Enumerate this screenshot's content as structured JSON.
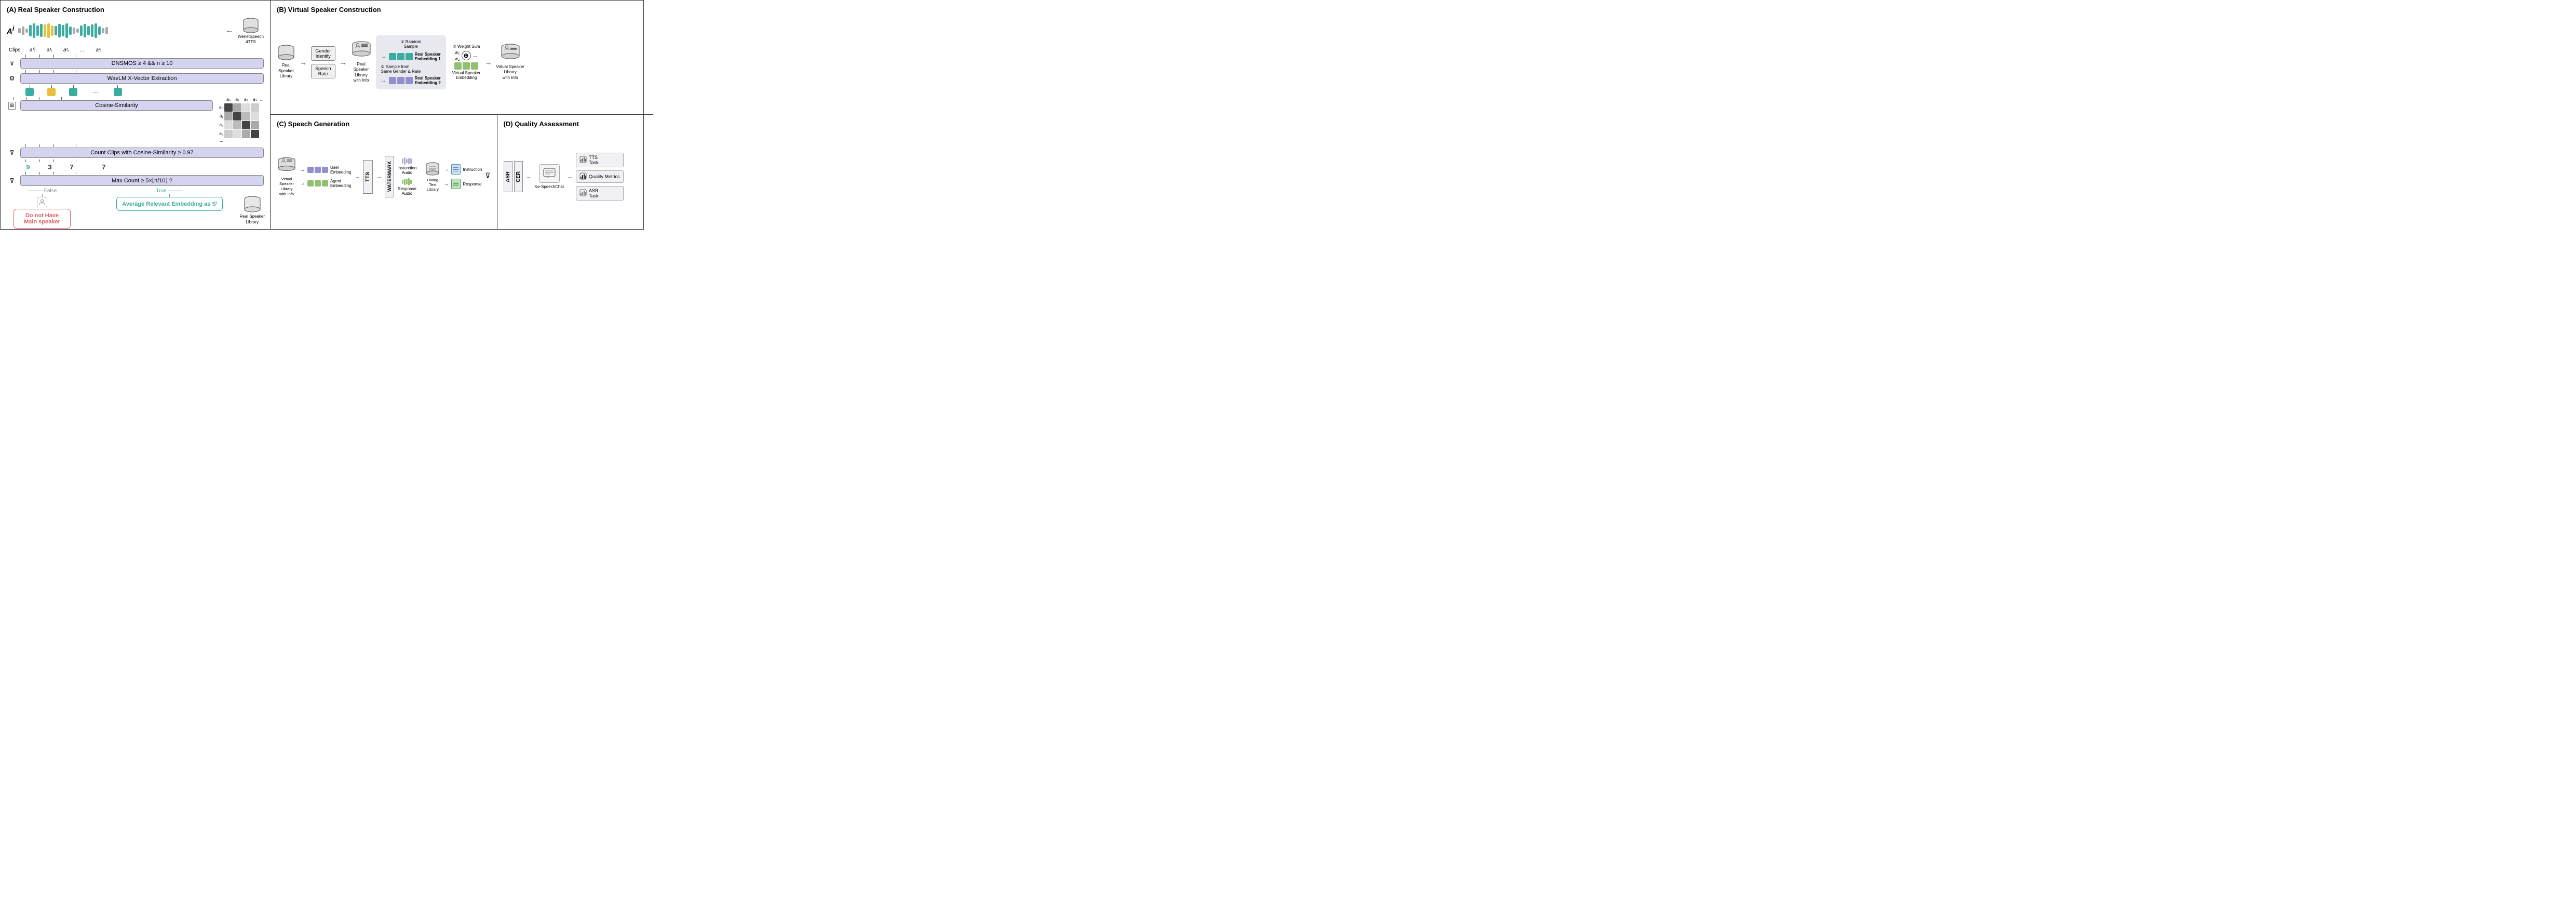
{
  "panels": {
    "a": {
      "title": "(A) Real Speaker Construction",
      "ai_label": "A",
      "ai_superscript": "i",
      "wenet_label": "WenetSpeech\n4TTS",
      "filter1": "DNSMOS ≥ 4 && n ≥ 10",
      "filter2": "WavLM X-Vector Extraction",
      "filter3": "Cosine-Similarity",
      "filter4": "Count Clips with Cosine-Similarity ≥ 0.97",
      "filter5": "Max Count ≥ 5×⌊n/10⌋ ?",
      "clips_label": "Clips",
      "clip_names": [
        "a⁰ᵢ",
        "a¹ᵢ",
        "a²ᵢ",
        "...",
        "aⁿᵢ"
      ],
      "counts": [
        "9",
        "3",
        "7",
        "7"
      ],
      "count_colors": [
        "teal",
        "black",
        "black",
        "black"
      ],
      "false_label": "False",
      "true_label": "True",
      "no_main_speaker": "Do not Have Main speaker",
      "avg_embedding": "Average Relevant Embedding as Sⁱ",
      "real_speaker_library": "Real Speaker\nLibrary",
      "matrix_labels": [
        "a₀",
        "a₁",
        "a₂",
        "a₃"
      ]
    },
    "b": {
      "title": "(B) Virtual Speaker Construction",
      "nodes": [
        {
          "label": "Real\nSpeaker\nLibrary"
        },
        {
          "label": "Gender\nIdentify"
        },
        {
          "label": "Speech\nRate"
        },
        {
          "label": "Real\nSpeaker\nLibrary\nwith Info"
        },
        {
          "label": "Real Speaker\nEmbedding 1"
        },
        {
          "label": "Real Speaker\nEmbedding 2"
        },
        {
          "label": "Virtual Speaker\nEmbedding"
        },
        {
          "label": "Virtual Speaker\nLibrary\nwith Info"
        }
      ],
      "steps": [
        "① Random\nSample",
        "② Sample from\nSame Gender & Rate",
        "③ Weight Sum"
      ],
      "weights": [
        "w₁",
        "w₂"
      ]
    },
    "c": {
      "title": "(C) Speech Generation",
      "nodes": [
        {
          "label": "Virtual\nSpeaker\nLibrary\nwith Info"
        },
        {
          "label": "Dialog\nText\nLibrary"
        }
      ],
      "embeddings": [
        {
          "label": "User Embedding"
        },
        {
          "label": "Agent Embedding"
        },
        {
          "label": "Instruction"
        },
        {
          "label": "Response"
        }
      ],
      "boxes": [
        "TTS",
        "WATERMARK"
      ],
      "audio_labels": [
        "Insturction\nAudio",
        "Response\nAudio"
      ],
      "filter_label": ""
    },
    "d": {
      "title": "(D) Quality Assessment",
      "boxes_vertical": [
        "ASR",
        "CER"
      ],
      "ke_speech": "Ke-SpeechChat",
      "tasks": [
        {
          "label": "TTS\nTask",
          "icon": "📊"
        },
        {
          "label": "Quality\nMetrics",
          "icon": "📊"
        },
        {
          "label": "ASR\nTask",
          "icon": "📊"
        }
      ]
    }
  },
  "colors": {
    "teal": "#3aada0",
    "yellow": "#e8c040",
    "purple": "#9090d0",
    "green": "#90c070",
    "light_purple": "#b0b0e0",
    "red": "#e06060",
    "panel_border": "#333333",
    "filter_bg": "#d4d4f0",
    "matrix_dark": "#555555",
    "matrix_mid": "#aaaaaa",
    "matrix_light": "#dddddd"
  }
}
